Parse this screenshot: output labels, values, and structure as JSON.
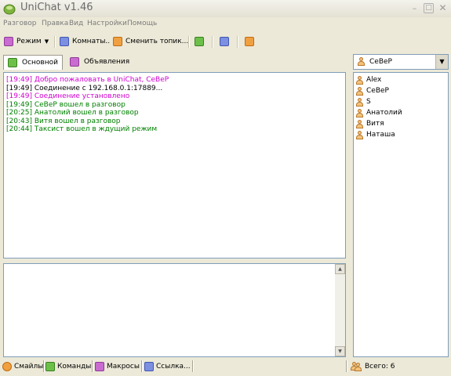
{
  "window": {
    "title": "UniChat v1.46"
  },
  "menu": [
    "Разговор",
    "Правка",
    "Вид",
    "Настройки",
    "Помощь"
  ],
  "toolbar": {
    "mode_label": "Режим",
    "rooms_label": "Комнаты..",
    "topic_label": "Сменить топик..."
  },
  "tabs": [
    {
      "label": "Основной",
      "active": true
    },
    {
      "label": "Объявления",
      "active": false
    }
  ],
  "messages": [
    {
      "time": "[19:49]",
      "text": "Добро пожаловать в UniChat, CeBeP",
      "color": "#d000d0"
    },
    {
      "time": "[19:49]",
      "text": "Соединение с 192.168.0.1:17889...",
      "color": "#000000"
    },
    {
      "time": "[19:49]",
      "text": "Соединение установлено",
      "color": "#d000d0"
    },
    {
      "time": "[19:49]",
      "text": "CeBeP вошел в разговор",
      "color": "#008000"
    },
    {
      "time": "[20:25]",
      "text": "Анатолий вошел в разговор",
      "color": "#008000"
    },
    {
      "time": "[20:43]",
      "text": "Витя вошел в разговор",
      "color": "#008000"
    },
    {
      "time": "[20:44]",
      "text": "Таксист вошел в ждущий режим",
      "color": "#008000"
    }
  ],
  "user_selector": {
    "value": "CeBeP"
  },
  "users": [
    {
      "name": "Alex"
    },
    {
      "name": "CeBeP"
    },
    {
      "name": "S"
    },
    {
      "name": "Анатолий"
    },
    {
      "name": "Витя"
    },
    {
      "name": "Наташа"
    }
  ],
  "statusbar": {
    "smileys": "Смайлы",
    "commands": "Команды",
    "macros": "Макросы",
    "links": "Ссылка...",
    "total": "Всего: 6"
  },
  "colors": {
    "system_message": "#d000d0",
    "join_message": "#008000",
    "panel_border": "#7f9db9",
    "window_bg": "#ece9d8"
  }
}
